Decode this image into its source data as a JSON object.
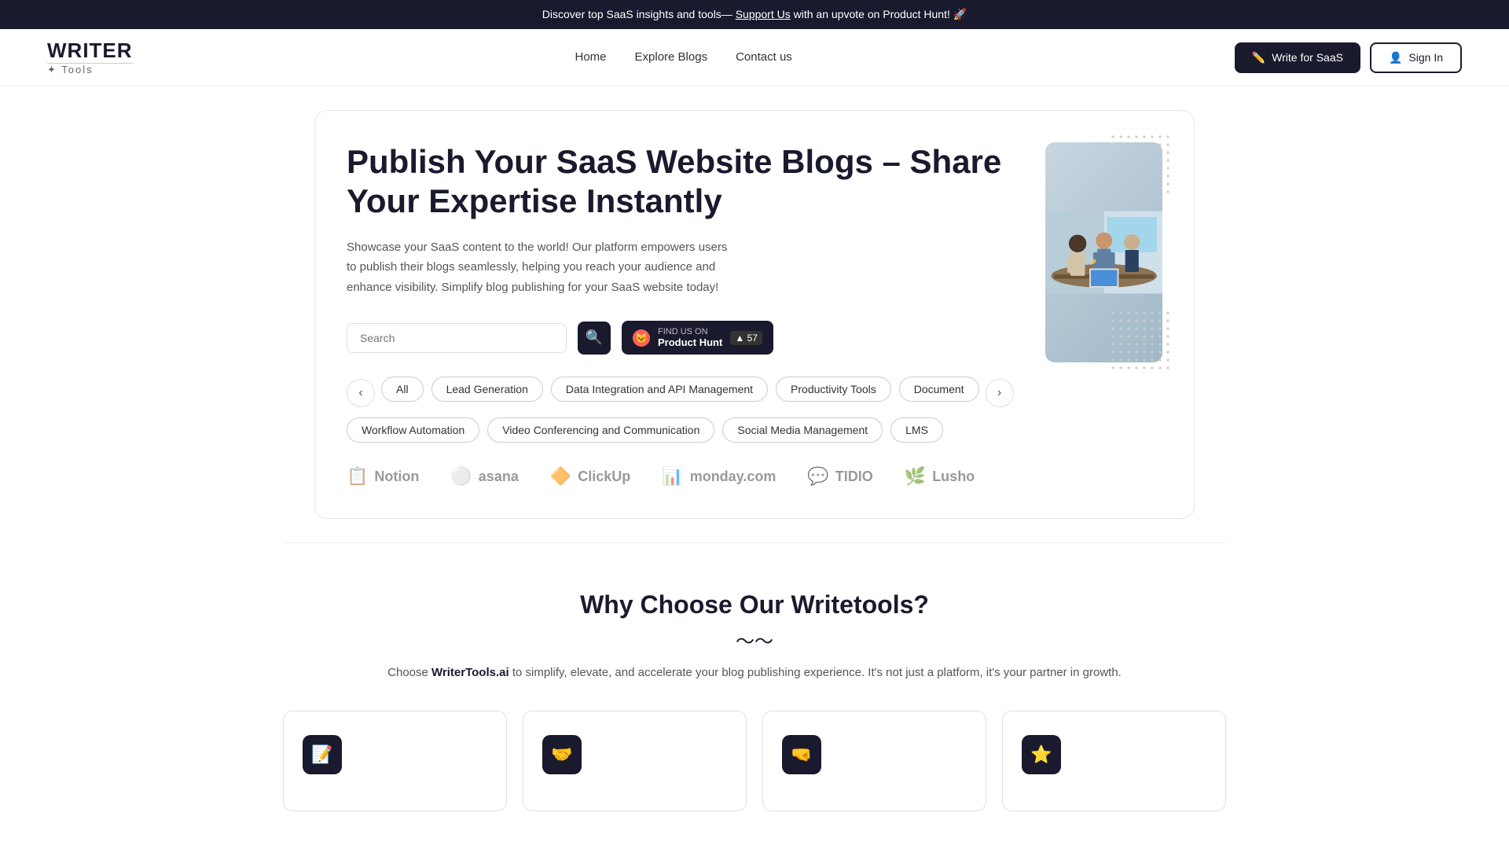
{
  "banner": {
    "text": "Discover top SaaS insights and tools—",
    "link_text": "Support Us",
    "suffix": " with an upvote on Product Hunt! 🚀"
  },
  "nav": {
    "logo_writer": "WRITER",
    "logo_tools": "✦ Tools",
    "links": [
      {
        "label": "Home",
        "href": "#"
      },
      {
        "label": "Explore Blogs",
        "href": "#"
      },
      {
        "label": "Contact us",
        "href": "#"
      }
    ],
    "write_btn": "Write for SaaS",
    "signin_btn": "Sign In"
  },
  "hero": {
    "title": "Publish Your SaaS Website Blogs – Share Your Expertise Instantly",
    "desc": "Showcase your SaaS content to the world! Our platform empowers users to publish their blogs seamlessly, helping you reach your audience and enhance visibility. Simplify blog publishing for your SaaS website today!",
    "search_placeholder": "Search",
    "ph_find": "FIND US ON",
    "ph_name": "Product Hunt",
    "ph_count": "57"
  },
  "categories": {
    "row1": [
      "All",
      "Lead Generation",
      "Data Integration and API Management",
      "Productivity Tools",
      "Document"
    ],
    "row2": [
      "Workflow Automation",
      "Video Conferencing and Communication",
      "Social Media Management",
      "LMS"
    ]
  },
  "logos": [
    {
      "name": "Notion",
      "icon": "📋"
    },
    {
      "name": "asana",
      "icon": "🔵"
    },
    {
      "name": "ClickUp",
      "icon": "🔶"
    },
    {
      "name": "monday.com",
      "icon": "📊"
    },
    {
      "name": "TIDIO",
      "icon": "💬"
    },
    {
      "name": "Lusho",
      "icon": "🌿"
    }
  ],
  "why": {
    "title": "Why Choose Our Writetools?",
    "underline": "〜〜",
    "desc_start": "Choose ",
    "desc_brand": "WriterTools.ai",
    "desc_end": " to simplify, elevate, and accelerate your blog publishing experience. It's not just a platform, it's your partner in growth."
  },
  "features": [
    {
      "icon": "📝",
      "id": "feature-1"
    },
    {
      "icon": "🤝",
      "id": "feature-2"
    },
    {
      "icon": "🤜",
      "id": "feature-3"
    },
    {
      "icon": "⭐",
      "id": "feature-4"
    }
  ]
}
